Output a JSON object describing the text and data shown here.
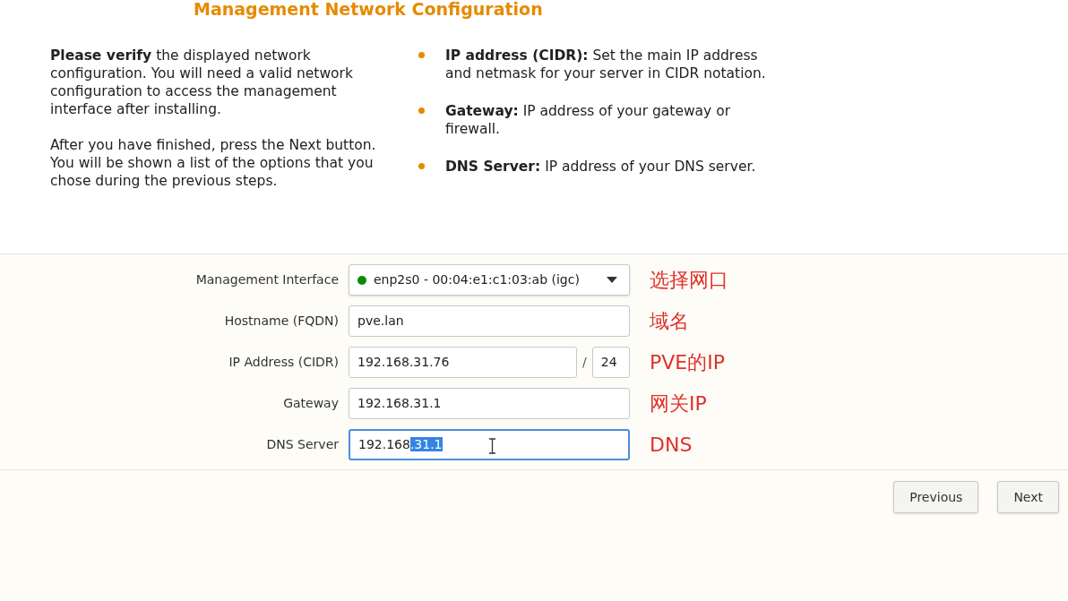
{
  "title": "Management Network Configuration",
  "intro": [
    "**Please verify** the displayed network configuration. You will need a valid network configuration to access the management interface after installing.",
    "After you have finished, press the Next button. You will be shown a list of the options that you chose during the previous steps."
  ],
  "bullets": [
    {
      "term": "IP address (CIDR):",
      "text": "Set the main IP address and netmask for your server in CIDR notation."
    },
    {
      "term": "Gateway:",
      "text": "IP address of your gateway or firewall."
    },
    {
      "term": "DNS Server:",
      "text": "IP address of your DNS server."
    }
  ],
  "fields": [
    {
      "kind": "select",
      "label": "Management Interface",
      "value": "enp2s0 - 00:04:e1:c1:03:ab (igc)",
      "color": "#0a8a0a",
      "note": "选择网口"
    },
    {
      "kind": "text",
      "label": "Hostname (FQDN)",
      "value": "pve.lan",
      "focused": false,
      "note": "域名"
    },
    {
      "kind": "cidr",
      "label": "IP Address (CIDR)",
      "value": "192.168.31.76",
      "separator": "/",
      "mask": "24",
      "note": "PVE的IP"
    },
    {
      "kind": "text",
      "label": "Gateway",
      "value": "192.168.31.1",
      "focused": false,
      "note": "网关IP"
    },
    {
      "kind": "text",
      "label": "DNS Server",
      "value": "192.168",
      "selection": ".31.1",
      "focused": true,
      "note": "DNS"
    }
  ],
  "buttons": [
    "Previous",
    "Next"
  ]
}
